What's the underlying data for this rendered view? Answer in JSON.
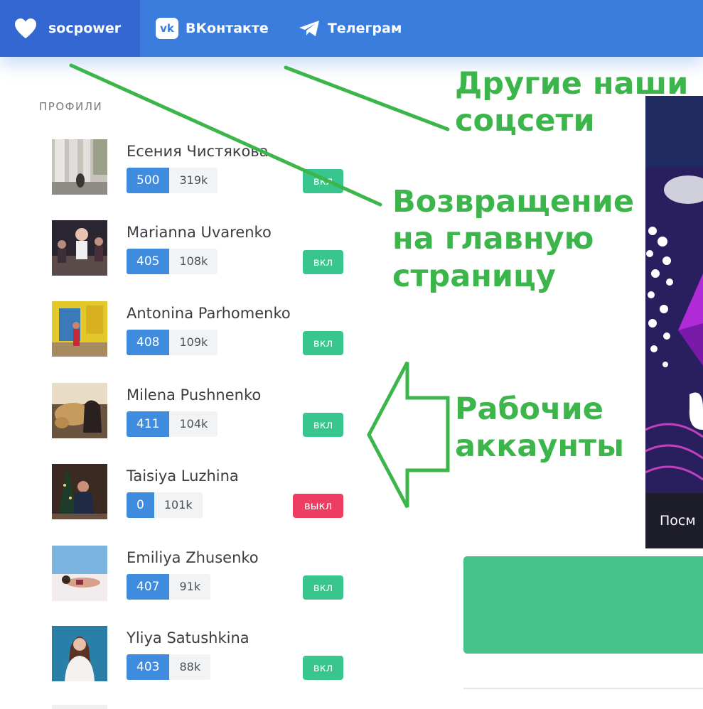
{
  "nav": {
    "brand": "socpower",
    "links": [
      {
        "label": "ВКонтакте",
        "icon": "vk-logo-icon"
      },
      {
        "label": "Телеграм",
        "icon": "telegram-icon"
      }
    ]
  },
  "profiles_label": "ПРОФИЛИ",
  "profiles": [
    {
      "name": "Есения Чистякова",
      "count": "500",
      "followers": "319k",
      "status": "вкл"
    },
    {
      "name": "Marianna Uvarenko",
      "count": "405",
      "followers": "108k",
      "status": "вкл"
    },
    {
      "name": "Antonina Parhomenko",
      "count": "408",
      "followers": "109k",
      "status": "вкл"
    },
    {
      "name": "Milena Pushnenko",
      "count": "411",
      "followers": "104k",
      "status": "вкл"
    },
    {
      "name": "Taisiya Luzhina",
      "count": "0",
      "followers": "101k",
      "status": "выкл"
    },
    {
      "name": "Emiliya Zhusenko",
      "count": "407",
      "followers": "91k",
      "status": "вкл"
    },
    {
      "name": "Yliya Satushkina",
      "count": "403",
      "followers": "88k",
      "status": "вкл"
    }
  ],
  "banner": {
    "caption": "Посм"
  },
  "annotations": {
    "social_line1": "Другие наши",
    "social_line2": "соцсети",
    "home_line1": "Возвращение",
    "home_line2": "на главную",
    "home_line3": "страницу",
    "accounts_line1": "Рабочие",
    "accounts_line2": "аккаунты"
  },
  "colors": {
    "navbar": "#3b7ddd",
    "brand_bg": "#3468d0",
    "count_badge": "#3f8cde",
    "status_on": "#39c68e",
    "status_off": "#ee3d62",
    "annotation": "#3cb54a"
  }
}
